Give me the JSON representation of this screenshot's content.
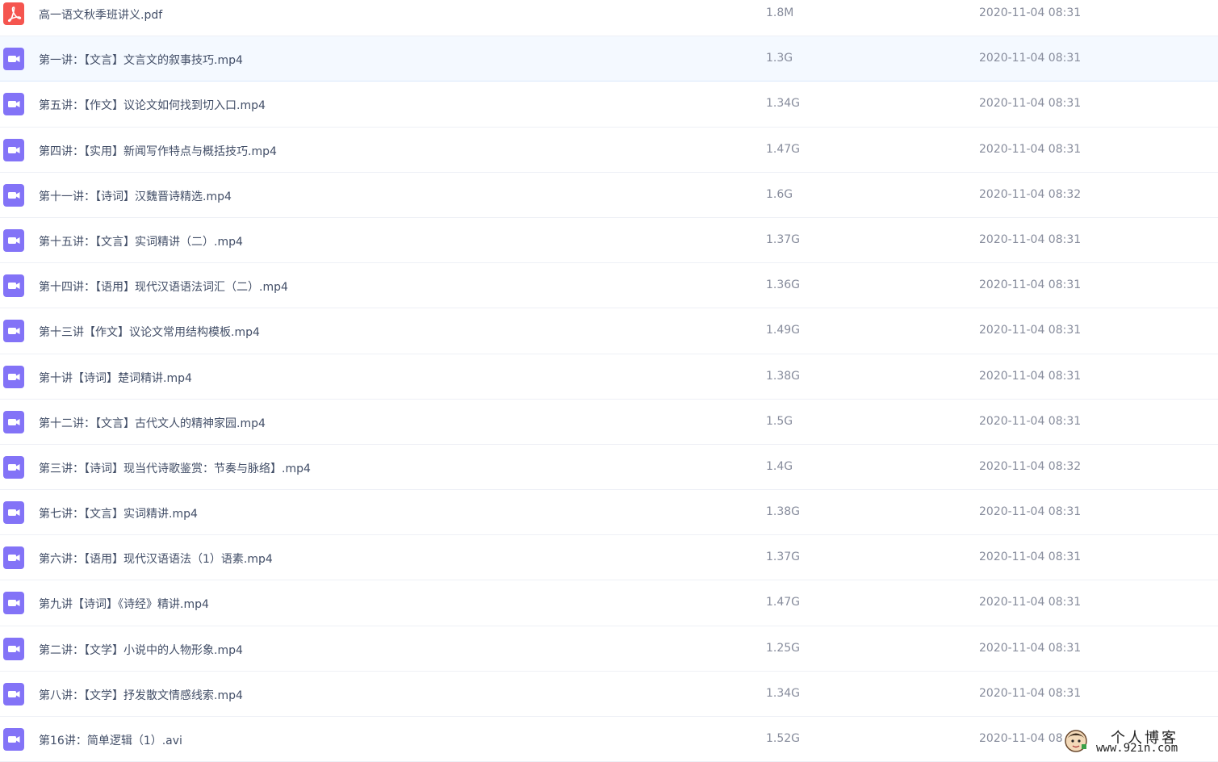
{
  "files": [
    {
      "type": "pdf",
      "icon": "pdf-file-icon",
      "name": "高一语文秋季班讲义.pdf",
      "size": "1.8M",
      "time": "2020-11-04 08:31"
    },
    {
      "type": "video",
      "icon": "video-file-icon",
      "name": "第一讲：【文言】文言文的叙事技巧.mp4",
      "size": "1.3G",
      "time": "2020-11-04 08:31"
    },
    {
      "type": "video",
      "icon": "video-file-icon",
      "name": "第五讲：【作文】议论文如何找到切入口.mp4",
      "size": "1.34G",
      "time": "2020-11-04 08:31"
    },
    {
      "type": "video",
      "icon": "video-file-icon",
      "name": "第四讲：【实用】新闻写作特点与概括技巧.mp4",
      "size": "1.47G",
      "time": "2020-11-04 08:31"
    },
    {
      "type": "video",
      "icon": "video-file-icon",
      "name": "第十一讲：【诗词】汉魏晋诗精选.mp4",
      "size": "1.6G",
      "time": "2020-11-04 08:32"
    },
    {
      "type": "video",
      "icon": "video-file-icon",
      "name": "第十五讲：【文言】实词精讲（二）.mp4",
      "size": "1.37G",
      "time": "2020-11-04 08:31"
    },
    {
      "type": "video",
      "icon": "video-file-icon",
      "name": "第十四讲：【语用】现代汉语语法词汇（二）.mp4",
      "size": "1.36G",
      "time": "2020-11-04 08:31"
    },
    {
      "type": "video",
      "icon": "video-file-icon",
      "name": "第十三讲【作文】议论文常用结构模板.mp4",
      "size": "1.49G",
      "time": "2020-11-04 08:31"
    },
    {
      "type": "video",
      "icon": "video-file-icon",
      "name": "第十讲【诗词】楚词精讲.mp4",
      "size": "1.38G",
      "time": "2020-11-04 08:31"
    },
    {
      "type": "video",
      "icon": "video-file-icon",
      "name": "第十二讲：【文言】古代文人的精神家园.mp4",
      "size": "1.5G",
      "time": "2020-11-04 08:31"
    },
    {
      "type": "video",
      "icon": "video-file-icon",
      "name": "第三讲：【诗词】现当代诗歌鉴赏：节奏与脉络】.mp4",
      "size": "1.4G",
      "time": "2020-11-04 08:32"
    },
    {
      "type": "video",
      "icon": "video-file-icon",
      "name": "第七讲：【文言】实词精讲.mp4",
      "size": "1.38G",
      "time": "2020-11-04 08:31"
    },
    {
      "type": "video",
      "icon": "video-file-icon",
      "name": "第六讲：【语用】现代汉语语法（1）语素.mp4",
      "size": "1.37G",
      "time": "2020-11-04 08:31"
    },
    {
      "type": "video",
      "icon": "video-file-icon",
      "name": "第九讲【诗词】《诗经》精讲.mp4",
      "size": "1.47G",
      "time": "2020-11-04 08:31"
    },
    {
      "type": "video",
      "icon": "video-file-icon",
      "name": "第二讲：【文学】小说中的人物形象.mp4",
      "size": "1.25G",
      "time": "2020-11-04 08:31"
    },
    {
      "type": "video",
      "icon": "video-file-icon",
      "name": "第八讲：【文学】抒发散文情感线索.mp4",
      "size": "1.34G",
      "time": "2020-11-04 08:31"
    },
    {
      "type": "video",
      "icon": "video-file-icon",
      "name": "第16讲：简单逻辑（1）.avi",
      "size": "1.52G",
      "time": "2020-11-04 08"
    }
  ],
  "hover_row": 1,
  "colors": {
    "pdf_icon": "#f5554f",
    "video_icon": "#8373f7",
    "row_hover": "#f4f9ff",
    "name_text": "#424e67",
    "meta_text": "#878c9c"
  },
  "watermark": {
    "title": "个人博客",
    "url": "www.92in.com"
  }
}
